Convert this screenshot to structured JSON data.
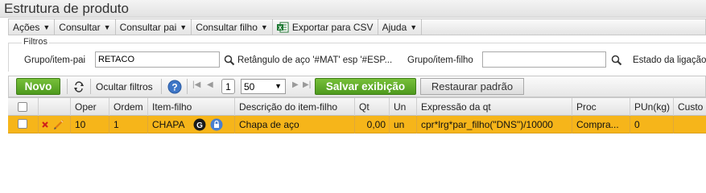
{
  "window": {
    "title": "Estrutura de produto"
  },
  "menu": [
    {
      "label": "Ações",
      "has_dropdown": true
    },
    {
      "label": "Consultar",
      "has_dropdown": true
    },
    {
      "label": "Consultar pai",
      "has_dropdown": true
    },
    {
      "label": "Consultar filho",
      "has_dropdown": true
    },
    {
      "label": "Exportar para CSV",
      "has_dropdown": false,
      "icon": "excel-icon"
    },
    {
      "label": "Ajuda",
      "has_dropdown": true
    }
  ],
  "filters": {
    "legend": "Filtros",
    "parent_group_label": "Grupo/item-pai",
    "parent_group_value": "RETACO",
    "parent_description": "Retângulo de aço '#MAT' esp '#ESP...",
    "child_group_label": "Grupo/item-filho",
    "child_group_value": "",
    "link_state_label": "Estado da ligação"
  },
  "toolbar": {
    "new_label": "Novo",
    "hide_filters_label": "Ocultar filtros",
    "page_number": "1",
    "page_size": "50",
    "save_view_label": "Salvar exibição",
    "restore_default_label": "Restaurar padrão"
  },
  "grid": {
    "columns": [
      "Oper",
      "Ordem",
      "Item-filho",
      "Descrição do item-filho",
      "Qt",
      "Un",
      "Expressão da qt",
      "Proc",
      "PUn(kg)",
      "Custo"
    ],
    "rows": [
      {
        "oper": "10",
        "ordem": "1",
        "item_filho": "CHAPA",
        "descricao": "Chapa de aço",
        "qt": "0,00",
        "un": "un",
        "expressao": "cpr*lrg*par_filho(\"DNS\")/10000",
        "proc": "Compra...",
        "pun": "0",
        "custo": ""
      }
    ]
  },
  "colors": {
    "selected_row": "#f6b51a",
    "green_button": "#5aa826",
    "delete_icon": "#d0201a",
    "edit_icon": "#e07a10",
    "lock_icon": "#4a7fd0"
  }
}
